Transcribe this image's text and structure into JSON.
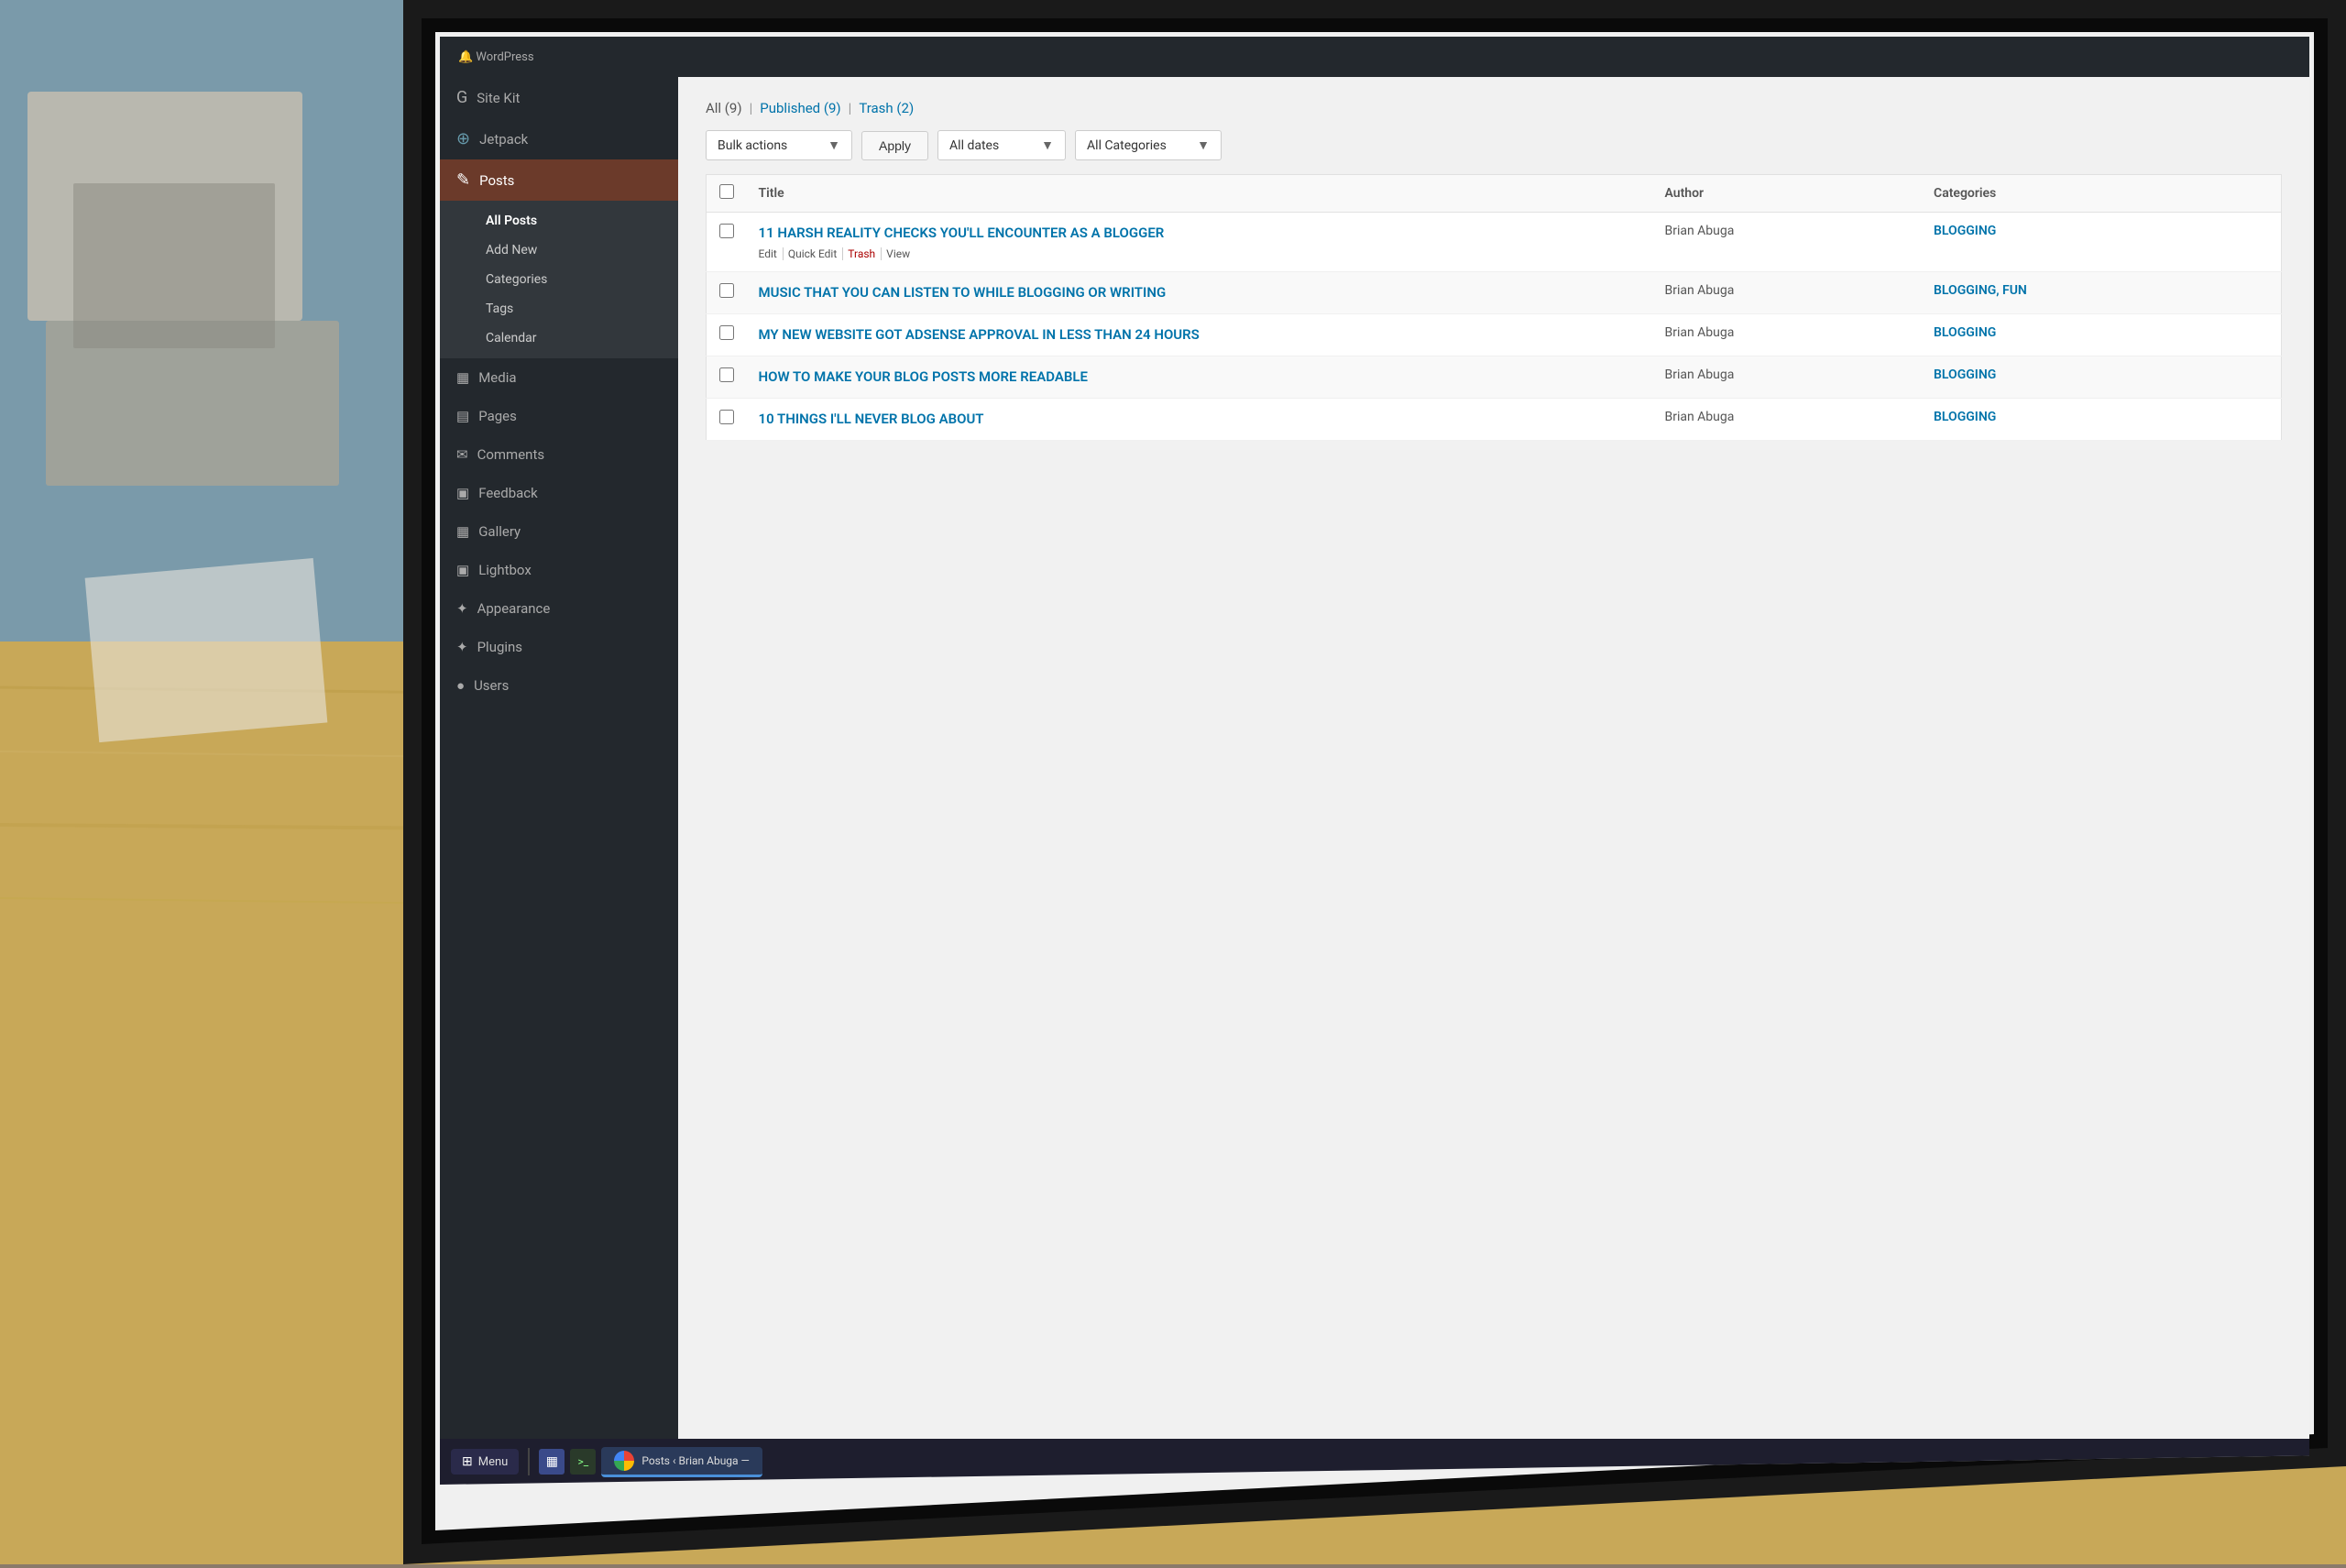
{
  "background": {
    "color": "#8a7a6a"
  },
  "screen": {
    "title": "Posts ‹ Brian Abuga —"
  },
  "sidebar": {
    "items": [
      {
        "id": "site-kit",
        "label": "Site Kit",
        "icon": "◉",
        "active": false
      },
      {
        "id": "jetpack",
        "label": "Jetpack",
        "icon": "⊕",
        "active": false
      },
      {
        "id": "posts",
        "label": "Posts",
        "icon": "✎",
        "active": true,
        "highlighted": true
      }
    ],
    "submenu_posts": [
      {
        "id": "all-posts",
        "label": "All Posts",
        "active": true
      },
      {
        "id": "add-new",
        "label": "Add New",
        "active": false
      },
      {
        "id": "categories",
        "label": "Categories",
        "active": false
      },
      {
        "id": "tags",
        "label": "Tags",
        "active": false
      },
      {
        "id": "calendar",
        "label": "Calendar",
        "active": false
      }
    ],
    "items_below": [
      {
        "id": "media",
        "label": "Media",
        "icon": "▦"
      },
      {
        "id": "pages",
        "label": "Pages",
        "icon": "▤"
      },
      {
        "id": "comments",
        "label": "Comments",
        "icon": "✉"
      },
      {
        "id": "feedback",
        "label": "Feedback",
        "icon": "▣"
      },
      {
        "id": "gallery",
        "label": "Gallery",
        "icon": "▦"
      },
      {
        "id": "lightbox",
        "label": "Lightbox",
        "icon": "▣"
      },
      {
        "id": "appearance",
        "label": "Appearance",
        "icon": "✦"
      },
      {
        "id": "plugins",
        "label": "Plugins",
        "icon": "✦"
      },
      {
        "id": "users",
        "label": "Users",
        "icon": "●"
      }
    ]
  },
  "filter_bar": {
    "all": "All (9)",
    "published": "Published (9)",
    "trash": "Trash (2)"
  },
  "action_bar": {
    "bulk_actions_label": "Bulk actions",
    "apply_label": "Apply",
    "all_dates_label": "All dates",
    "all_categories_label": "All Categories"
  },
  "table": {
    "headers": {
      "checkbox": "",
      "title": "Title",
      "author": "Author",
      "categories": "Categories"
    },
    "posts": [
      {
        "id": 1,
        "title": "11 HARSH REALITY CHECKS YOU'LL ENCOUNTER AS A BLOGGER",
        "author": "Brian Abuga",
        "categories": "BLOGGING",
        "row_actions": [
          "Edit",
          "Quick Edit",
          "Trash",
          "View"
        ],
        "checked": false
      },
      {
        "id": 2,
        "title": "MUSIC THAT YOU CAN LISTEN TO WHILE BLOGGING OR WRITING",
        "author": "Brian Abuga",
        "categories": "BLOGGING, FUN",
        "row_actions": [],
        "checked": false
      },
      {
        "id": 3,
        "title": "MY NEW WEBSITE GOT ADSENSE APPROVAL IN LESS THAN 24 HOURS",
        "author": "Brian Abuga",
        "categories": "BLOGGING",
        "row_actions": [],
        "checked": false
      },
      {
        "id": 4,
        "title": "HOW TO MAKE YOUR BLOG POSTS MORE READABLE",
        "author": "Brian Abuga",
        "categories": "BLOGGING",
        "row_actions": [],
        "checked": false
      },
      {
        "id": 5,
        "title": "10 THINGS I'LL NEVER BLOG ABOUT",
        "author": "Brian Abuga",
        "categories": "BLOGGING",
        "row_actions": [],
        "checked": false
      }
    ]
  },
  "taskbar": {
    "start_label": "Menu",
    "browser_label": "Posts ‹ Brian Abuga —"
  }
}
